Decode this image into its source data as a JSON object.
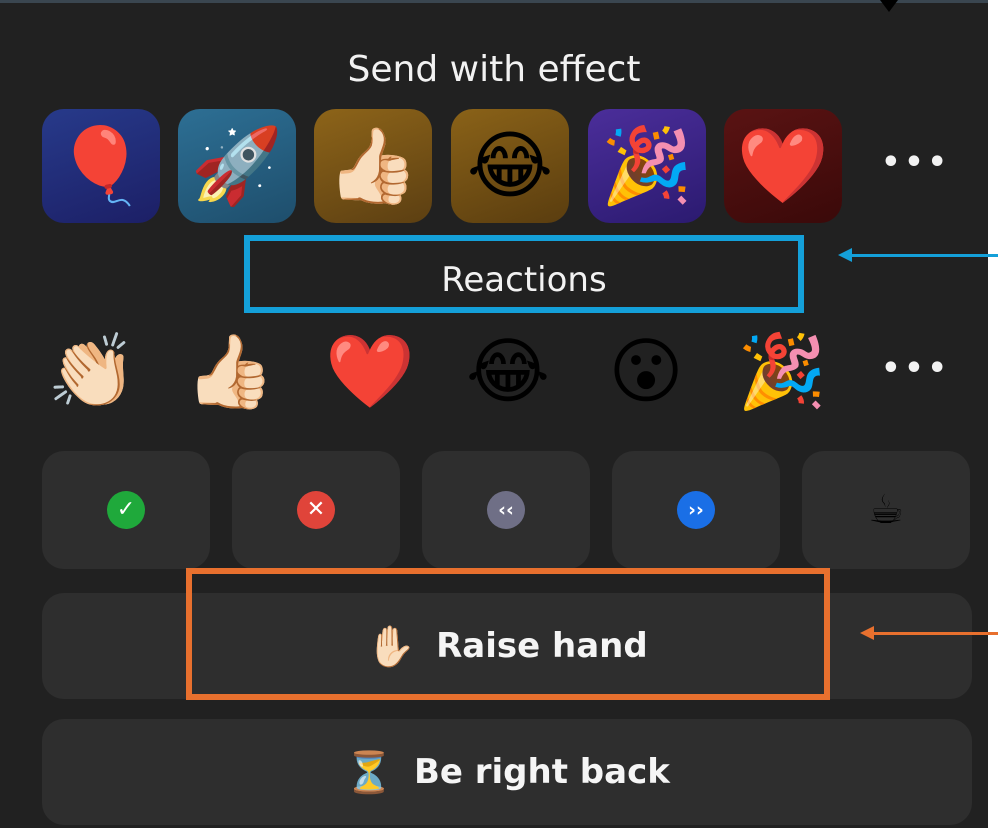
{
  "effects": {
    "title": "Send with effect",
    "items": [
      {
        "name": "balloon",
        "glyph": "🎈"
      },
      {
        "name": "rocket",
        "glyph": "🚀"
      },
      {
        "name": "thumbs-up",
        "glyph": "👍🏻"
      },
      {
        "name": "laughing",
        "glyph": "😂"
      },
      {
        "name": "party-popper",
        "glyph": "🎉"
      },
      {
        "name": "heart",
        "glyph": "❤️"
      }
    ],
    "more_label": "•••"
  },
  "reactions": {
    "title": "Reactions",
    "items": [
      {
        "name": "clapping-hands",
        "glyph": "👏🏻"
      },
      {
        "name": "thumbs-up",
        "glyph": "👍🏻"
      },
      {
        "name": "heart",
        "glyph": "❤️"
      },
      {
        "name": "laughing",
        "glyph": "😂"
      },
      {
        "name": "surprised",
        "glyph": "😮"
      },
      {
        "name": "party-popper",
        "glyph": "🎉"
      }
    ],
    "more_label": "•••"
  },
  "quick_actions": [
    {
      "name": "yes",
      "icon": "check-icon",
      "glyph": "✓"
    },
    {
      "name": "no",
      "icon": "x-icon",
      "glyph": "✕"
    },
    {
      "name": "slow-down",
      "icon": "rewind-icon",
      "glyph": "‹‹"
    },
    {
      "name": "speed-up",
      "icon": "fast-forward-icon",
      "glyph": "››"
    },
    {
      "name": "coffee",
      "icon": "coffee-icon",
      "glyph": "☕"
    }
  ],
  "raise_hand": {
    "glyph": "✋🏻",
    "label": "Raise hand"
  },
  "be_right_back": {
    "glyph": "⏳",
    "label": "Be right back"
  },
  "colors": {
    "panel_bg": "#212121",
    "button_bg": "#2e2e2e",
    "annotation_blue": "#14a0d9",
    "annotation_orange": "#e8702e"
  }
}
